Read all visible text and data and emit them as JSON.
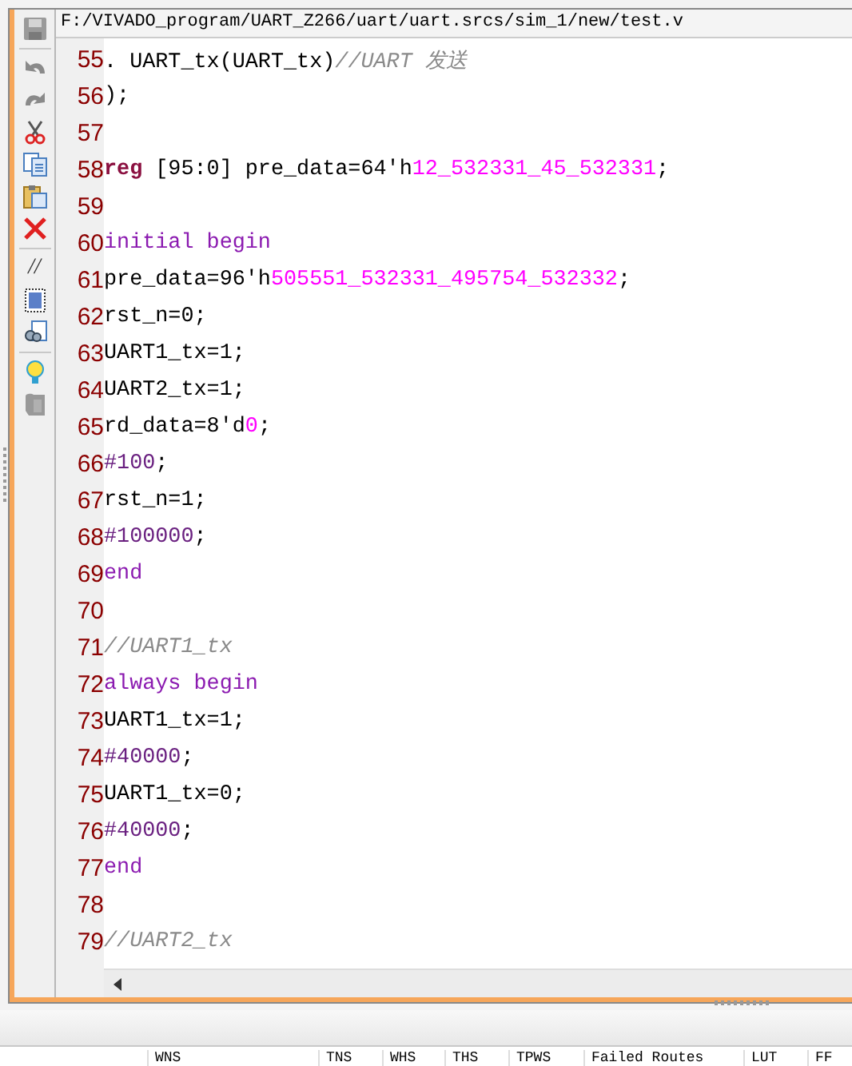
{
  "file_path": "F:/VIVADO_program/UART_Z266/uart/uart.srcs/sim_1/new/test.v",
  "toolbar": {
    "comment_label": "//"
  },
  "code_lines": [
    {
      "number": "55",
      "segments": [
        {
          "kind": "plain",
          "text": ". UART_tx(UART_tx)"
        },
        {
          "kind": "comment",
          "text": "//UART 发送"
        }
      ]
    },
    {
      "number": "56",
      "segments": [
        {
          "kind": "plain",
          "text": ");"
        }
      ]
    },
    {
      "number": "57"
    },
    {
      "number": "58",
      "segments": [
        {
          "kind": "type",
          "text": "reg"
        },
        {
          "kind": "plain",
          "text": " [95:0] pre_data=64'h"
        },
        {
          "kind": "number",
          "text": "12_532331_45_532331"
        },
        {
          "kind": "plain",
          "text": ";"
        }
      ]
    },
    {
      "number": "59"
    },
    {
      "number": "60",
      "segments": [
        {
          "kind": "keyword",
          "text": "initial begin"
        }
      ]
    },
    {
      "number": "61",
      "segments": [
        {
          "kind": "plain",
          "text": "pre_data=96'h"
        },
        {
          "kind": "number",
          "text": "505551_532331_495754_532332"
        },
        {
          "kind": "plain",
          "text": ";"
        }
      ]
    },
    {
      "number": "62",
      "segments": [
        {
          "kind": "plain",
          "text": "rst_n=0;"
        }
      ]
    },
    {
      "number": "63",
      "segments": [
        {
          "kind": "plain",
          "text": "UART1_tx=1;"
        }
      ]
    },
    {
      "number": "64",
      "segments": [
        {
          "kind": "plain",
          "text": "UART2_tx=1;"
        }
      ]
    },
    {
      "number": "65",
      "segments": [
        {
          "kind": "plain",
          "text": "rd_data=8'd"
        },
        {
          "kind": "number",
          "text": "0"
        },
        {
          "kind": "plain",
          "text": ";"
        }
      ]
    },
    {
      "number": "66",
      "segments": [
        {
          "kind": "delay",
          "text": "#100"
        },
        {
          "kind": "plain",
          "text": ";"
        }
      ]
    },
    {
      "number": "67",
      "segments": [
        {
          "kind": "plain",
          "text": "rst_n=1;"
        }
      ]
    },
    {
      "number": "68",
      "segments": [
        {
          "kind": "delay",
          "text": "#100000"
        },
        {
          "kind": "plain",
          "text": ";"
        }
      ]
    },
    {
      "number": "69",
      "segments": [
        {
          "kind": "keyword",
          "text": "end"
        }
      ]
    },
    {
      "number": "70"
    },
    {
      "number": "71",
      "segments": [
        {
          "kind": "comment",
          "text": "//UART1_tx"
        }
      ]
    },
    {
      "number": "72",
      "segments": [
        {
          "kind": "keyword",
          "text": "always begin"
        }
      ]
    },
    {
      "number": "73",
      "segments": [
        {
          "kind": "plain",
          "text": "UART1_tx=1;"
        }
      ]
    },
    {
      "number": "74",
      "segments": [
        {
          "kind": "delay",
          "text": "#40000"
        },
        {
          "kind": "plain",
          "text": ";"
        }
      ]
    },
    {
      "number": "75",
      "segments": [
        {
          "kind": "plain",
          "text": "UART1_tx=0;"
        }
      ]
    },
    {
      "number": "76",
      "segments": [
        {
          "kind": "delay",
          "text": "#40000"
        },
        {
          "kind": "plain",
          "text": ";"
        }
      ]
    },
    {
      "number": "77",
      "segments": [
        {
          "kind": "keyword",
          "text": "end"
        }
      ]
    },
    {
      "number": "78"
    },
    {
      "number": "79",
      "segments": [
        {
          "kind": "comment",
          "text": "//UART2_tx"
        }
      ]
    }
  ],
  "results_table": {
    "columns": [
      "WNS",
      "TNS",
      "WHS",
      "THS",
      "TPWS",
      "Failed Routes",
      "LUT",
      "FF"
    ]
  }
}
